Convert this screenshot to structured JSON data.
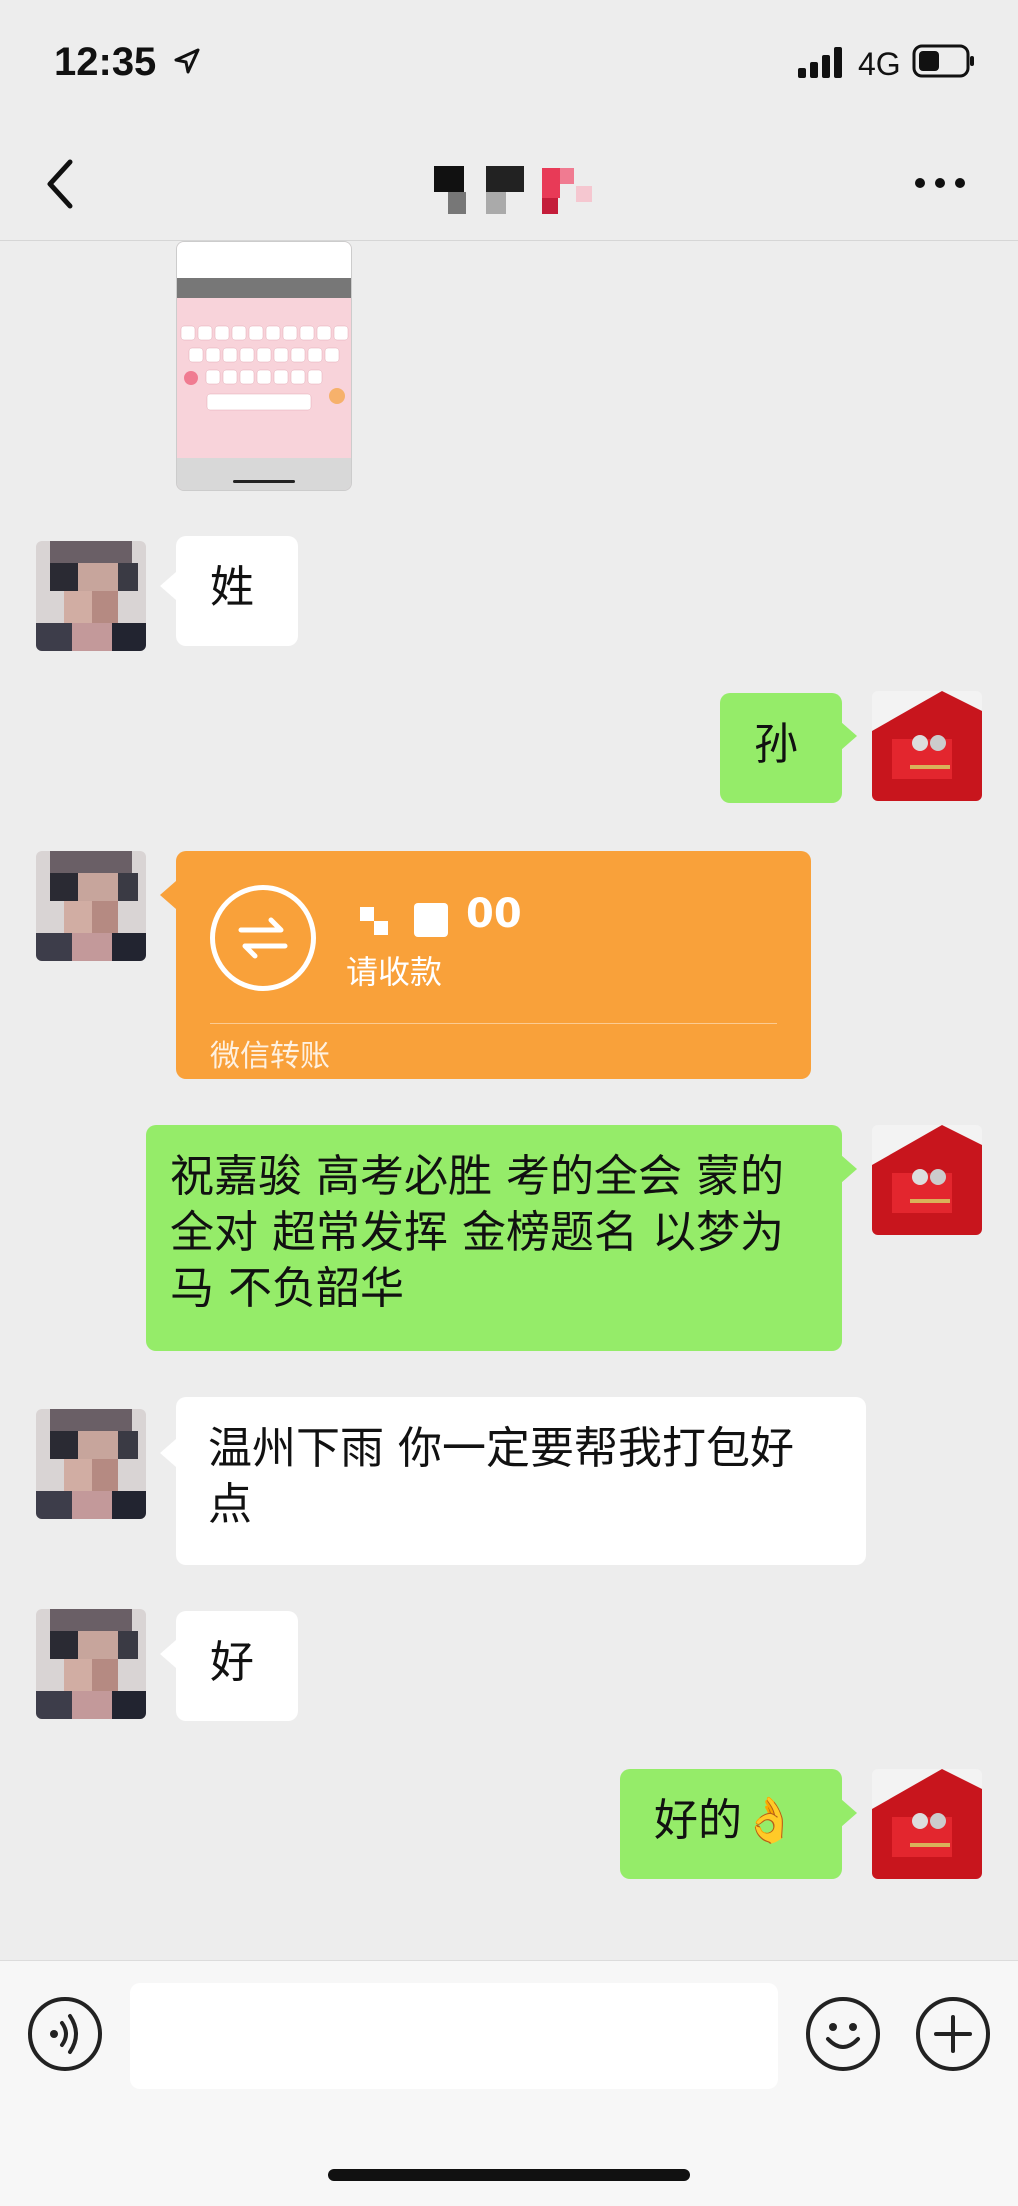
{
  "status_bar": {
    "time": "12:35",
    "network": "4G",
    "icons": [
      "location-arrow-icon",
      "signal-icon",
      "battery-icon"
    ]
  },
  "nav": {
    "back_icon": "chevron-left-icon",
    "more_icon": "more-dots-icon"
  },
  "messages": [
    {
      "side": "right",
      "type": "image",
      "content": "keyboard-screenshot"
    },
    {
      "side": "left",
      "type": "text",
      "text": "姓"
    },
    {
      "side": "right",
      "type": "text",
      "text": "孙"
    },
    {
      "side": "left",
      "type": "transfer",
      "amount": "00",
      "status": "请收款",
      "footer": "微信转账"
    },
    {
      "side": "right",
      "type": "text",
      "text": "祝嘉骏 高考必胜 考的全会 蒙的全对 超常发挥 金榜题名 以梦为马 不负韶华"
    },
    {
      "side": "left",
      "type": "text",
      "text": "温州下雨 你一定要帮我打包好点"
    },
    {
      "side": "left",
      "type": "text",
      "text": "好"
    },
    {
      "side": "right",
      "type": "text",
      "text": "好的👌"
    }
  ],
  "input_bar": {
    "voice_icon": "voice-icon",
    "emoji_icon": "emoji-icon",
    "plus_icon": "plus-icon",
    "input_value": ""
  },
  "colors": {
    "background": "#ededed",
    "green_bubble": "#95ec69",
    "white_bubble": "#ffffff",
    "transfer": "#f9a13a"
  }
}
